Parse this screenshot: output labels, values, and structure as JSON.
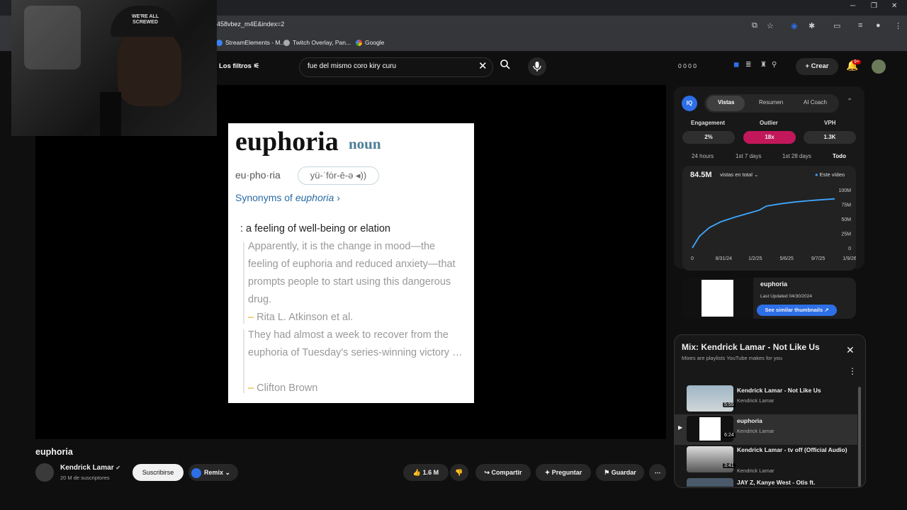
{
  "browser": {
    "url": "458vbez_m4E&index=2",
    "bookmarks": [
      "StreamElements - M...",
      "Twitch Overlay, Pan...",
      "Google"
    ]
  },
  "header": {
    "filters_label": "Los filtros",
    "search_value": "fue del mismo coro kiry curu",
    "stats_text": "0 0 0 0",
    "create_label": "Crear",
    "notifications_badge": "9+"
  },
  "webcam": {
    "hat_text": "WE'RE ALL SCREWED"
  },
  "dictionary": {
    "word": "euphoria",
    "part_of_speech": "noun",
    "syllables": "eu·pho·ria",
    "pronunciation": "yü-ˈfȯr-ē-ə ◂))",
    "synonyms_prefix": "Synonyms of",
    "synonyms_word": "euphoria",
    "definition": ": a feeling of well-being or elation",
    "example1": "Apparently, it is the change in mood—the feeling of euphoria and reduced anxiety—that prompts people to start using this dangerous drug.",
    "example1_attr": "Rita L. Atkinson et al.",
    "example2": "They had almost a week to recover from the euphoria of Tuesday's series-winning victory …",
    "example2_attr": "Clifton Brown"
  },
  "vidiq": {
    "logo": "IQ",
    "tabs": [
      "Vistas",
      "Resumen",
      "AI Coach"
    ],
    "metric_labels": [
      "Engagement",
      "Outlier",
      "VPH"
    ],
    "metric_values": [
      "2%",
      "18x",
      "1.3K"
    ],
    "ranges": [
      "24 hours",
      "1st 7 days",
      "1st 28 days",
      "Todo"
    ],
    "total": "84.5M",
    "total_label": "vistas en total",
    "legend": "Este vídeo",
    "thumb_title": "euphoria",
    "thumb_date": "Last Updated 04/30/2024",
    "similar_button": "See similar thumbnails"
  },
  "chart_data": {
    "type": "line",
    "x_ticks": [
      "0",
      "8/31/24",
      "1/2/25",
      "5/6/25",
      "9/7/25",
      "1/9/26"
    ],
    "y_ticks": [
      "100M",
      "75M",
      "50M",
      "25M",
      "0"
    ],
    "ylim": [
      0,
      100
    ],
    "series": [
      {
        "name": "Este vídeo",
        "color": "#3ea6ff",
        "points": [
          [
            0,
            0
          ],
          [
            0.05,
            20
          ],
          [
            0.12,
            35
          ],
          [
            0.2,
            45
          ],
          [
            0.3,
            53
          ],
          [
            0.4,
            60
          ],
          [
            0.47,
            65
          ],
          [
            0.52,
            72
          ],
          [
            0.62,
            76
          ],
          [
            0.72,
            79
          ],
          [
            0.85,
            82
          ],
          [
            1.0,
            84.5
          ]
        ]
      }
    ]
  },
  "mix": {
    "title": "Mix: Kendrick Lamar - Not Like Us",
    "subtitle": "Mixes are playlists YouTube makes for you",
    "items": [
      {
        "title": "Kendrick Lamar - Not Like Us",
        "artist": "Kendrick Lamar",
        "duration": "5:55"
      },
      {
        "title": "euphoria",
        "artist": "Kendrick Lamar",
        "duration": "6:24"
      },
      {
        "title": "Kendrick Lamar - tv off (Official Audio)",
        "artist": "Kendrick Lamar",
        "duration": "3:41"
      },
      {
        "title": "JAY Z, Kanye West - Otis ft.",
        "artist": "",
        "duration": ""
      }
    ]
  },
  "video": {
    "title": "euphoria",
    "channel": "Kendrick Lamar",
    "subscribers": "20 M de suscriptores",
    "subscribe_label": "Suscribirse",
    "remix_label": "Remix",
    "likes": "1.6 M",
    "share_label": "Compartir",
    "ask_label": "Preguntar",
    "save_label": "Guardar"
  }
}
